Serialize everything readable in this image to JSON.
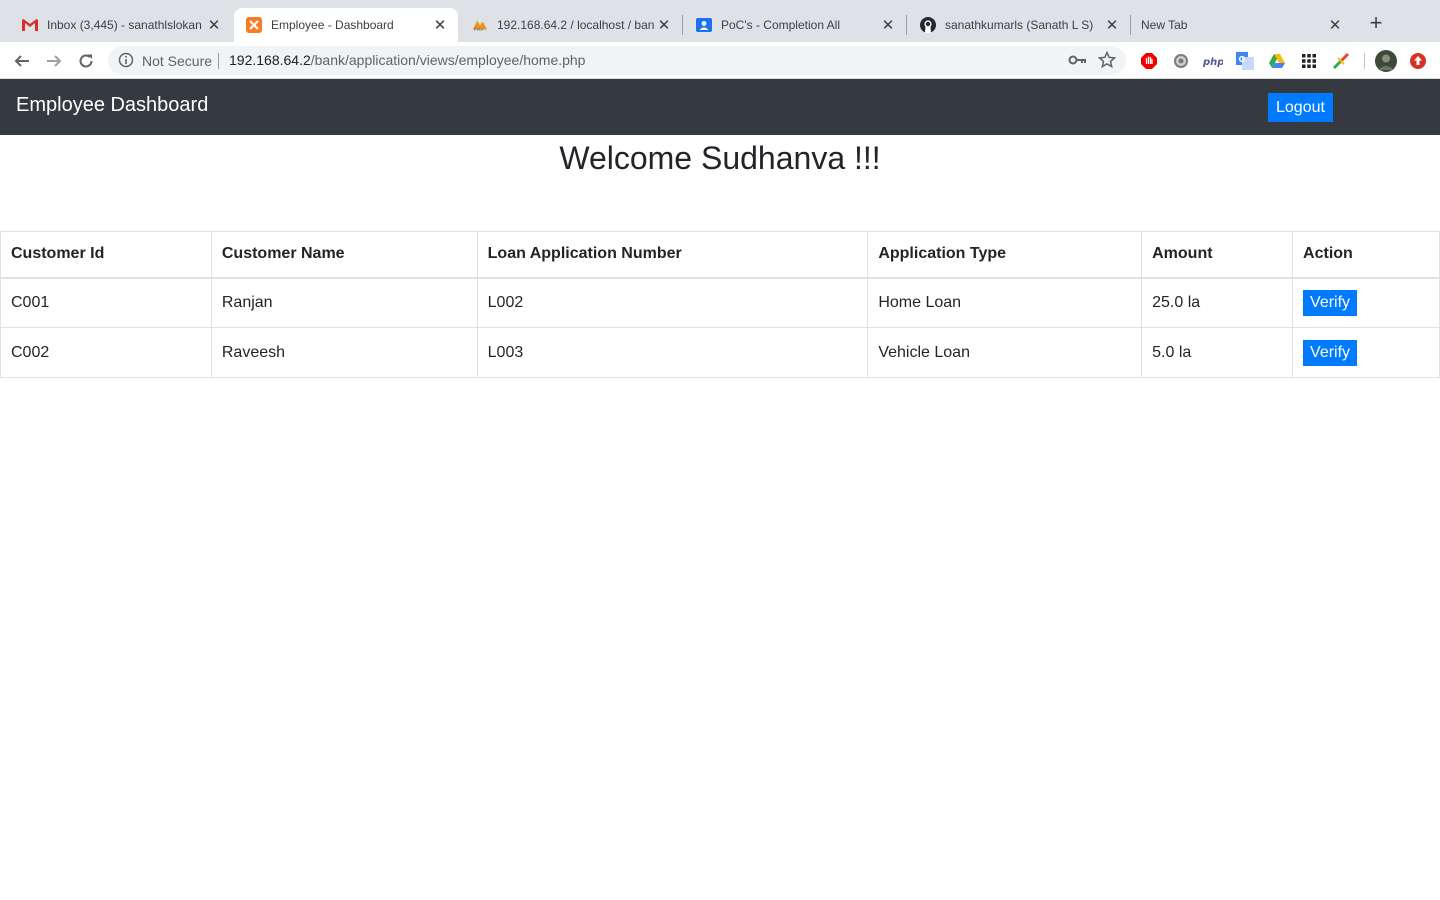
{
  "browser": {
    "tabs": [
      {
        "title": "Inbox (3,445) - sanathlslokan",
        "icon": "gmail-icon",
        "active": false
      },
      {
        "title": "Employee - Dashboard",
        "icon": "xampp-icon",
        "active": true
      },
      {
        "title": "192.168.64.2 / localhost / ban",
        "icon": "phpmyadmin-icon",
        "active": false
      },
      {
        "title": "PoC's - Completion All",
        "icon": "classroom-icon",
        "active": false
      },
      {
        "title": "sanathkumarls (Sanath L S)",
        "icon": "github-icon",
        "active": false
      },
      {
        "title": "New Tab",
        "icon": "",
        "active": false
      }
    ],
    "security_label": "Not Secure",
    "url_host": "192.168.64.2",
    "url_path": "/bank/application/views/employee/home.php",
    "accent": "#1a73e8"
  },
  "navbar": {
    "brand": "Employee Dashboard",
    "logout_label": "Logout",
    "bg_color": "#343a40",
    "button_color": "#007bff"
  },
  "main": {
    "welcome": "Welcome Sudhanva !!!"
  },
  "table": {
    "headers": [
      "Customer Id",
      "Customer Name",
      "Loan Application Number",
      "Application Type",
      "Amount",
      "Action"
    ],
    "rows": [
      {
        "customer_id": "C001",
        "customer_name": "Ranjan",
        "loan_number": "L002",
        "type": "Home Loan",
        "amount": "25.0 la",
        "action": "Verify"
      },
      {
        "customer_id": "C002",
        "customer_name": "Raveesh",
        "loan_number": "L003",
        "type": "Vehicle Loan",
        "amount": "5.0 la",
        "action": "Verify"
      }
    ]
  }
}
